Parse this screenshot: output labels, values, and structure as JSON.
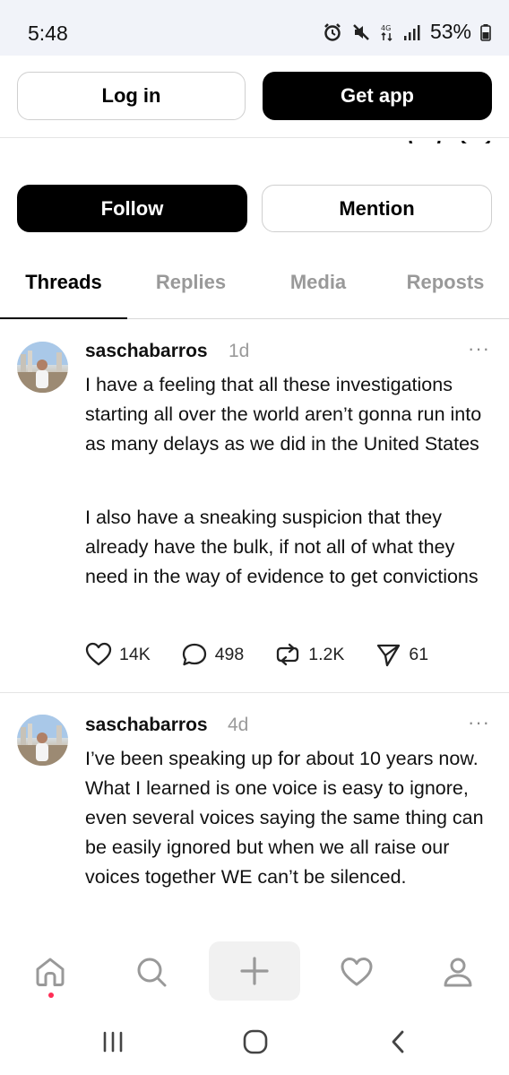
{
  "status_bar": {
    "time": "5:48",
    "battery": "53%",
    "icons": [
      "alarm-icon",
      "mute-icon",
      "data-icon",
      "signal-icon",
      "battery-icon"
    ]
  },
  "top_actions": {
    "login_label": "Log in",
    "get_app_label": "Get app"
  },
  "profile_actions": {
    "follow_label": "Follow",
    "mention_label": "Mention"
  },
  "tabs": [
    {
      "label": "Threads",
      "active": true
    },
    {
      "label": "Replies",
      "active": false
    },
    {
      "label": "Media",
      "active": false
    },
    {
      "label": "Reposts",
      "active": false
    }
  ],
  "posts": [
    {
      "username": "saschabarros",
      "time": "1d",
      "paragraphs": [
        "I have a feeling that all these investigations starting all over the world aren’t gonna run into as many delays as we did in the United States",
        "I also have a sneaking suspicion that they already have the bulk, if not all of what they need in the way of evidence to get convictions"
      ],
      "likes": "14K",
      "replies": "498",
      "reposts": "1.2K",
      "shares": "61"
    },
    {
      "username": "saschabarros",
      "time": "4d",
      "paragraphs": [
        "I’ve been speaking up for about 10 years now. What I learned is one voice is easy to ignore, even several voices saying the same thing can be easily ignored but when we all raise our voices together WE can’t be silenced."
      ]
    }
  ],
  "more_label": "···",
  "colors": {
    "accent": "#000000",
    "muted": "#999999",
    "notification": "#ff2d55",
    "status_bar_bg": "#f1f3f9"
  },
  "bottom_nav": [
    "home-icon",
    "search-icon",
    "create-icon",
    "activity-heart-icon",
    "profile-icon"
  ],
  "system_nav": [
    "recent-apps-icon",
    "home-circle-icon",
    "back-icon"
  ]
}
